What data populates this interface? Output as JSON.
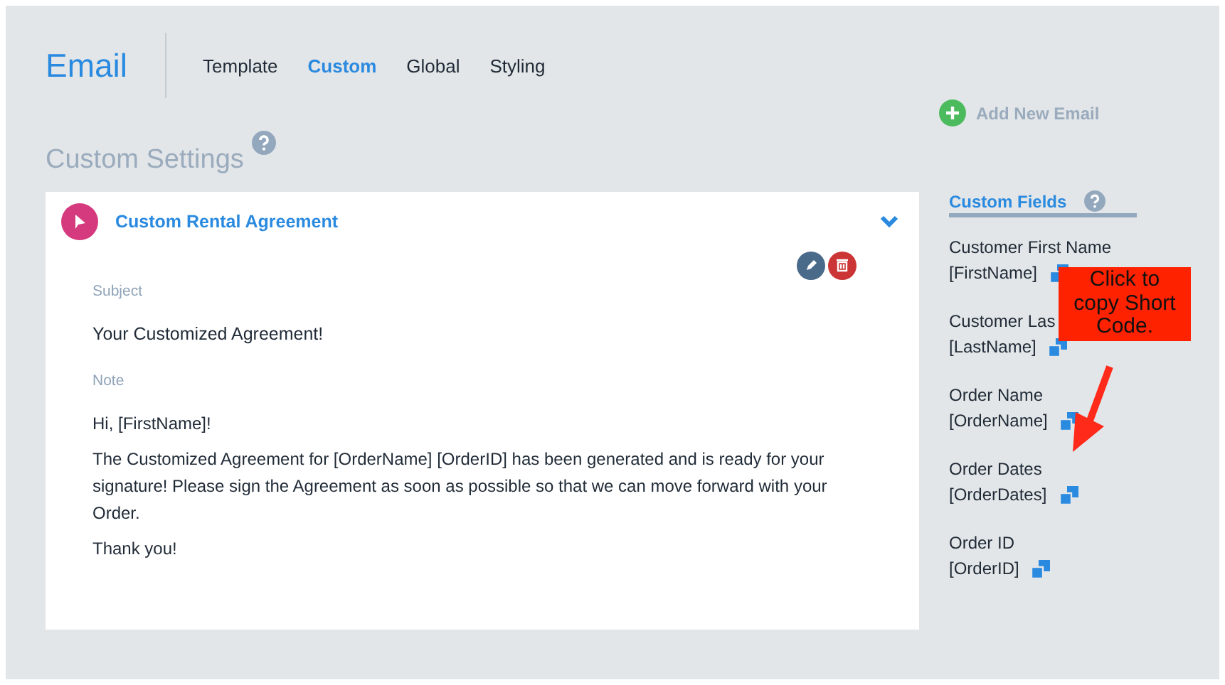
{
  "header": {
    "title": "Email",
    "tabs": [
      {
        "label": "Template",
        "selected": false
      },
      {
        "label": "Custom",
        "selected": true
      },
      {
        "label": "Global",
        "selected": false
      },
      {
        "label": "Styling",
        "selected": false
      }
    ],
    "add_button": "Add New Email"
  },
  "section_title": "Custom Settings",
  "card": {
    "title": "Custom Rental Agreement",
    "expanded": true,
    "subject_label": "Subject",
    "subject": "Your Customized Agreement!",
    "note_label": "Note",
    "note": [
      "Hi, [FirstName]!",
      "The Customized Agreement for [OrderName] [OrderID] has been generated and is ready for your signature! Please sign the Agreement as soon as possible so that we can move forward with your Order.",
      "Thank you!"
    ]
  },
  "custom_fields": {
    "title": "Custom Fields",
    "items": [
      {
        "name": "Customer First Name",
        "code": "[FirstName]"
      },
      {
        "name": "Customer Las",
        "code": "[LastName]"
      },
      {
        "name": "Order Name",
        "code": "[OrderName]"
      },
      {
        "name": "Order Dates",
        "code": "[OrderDates]"
      },
      {
        "name": "Order ID",
        "code": "[OrderID]"
      }
    ]
  },
  "callout": "Click to copy Short Code."
}
